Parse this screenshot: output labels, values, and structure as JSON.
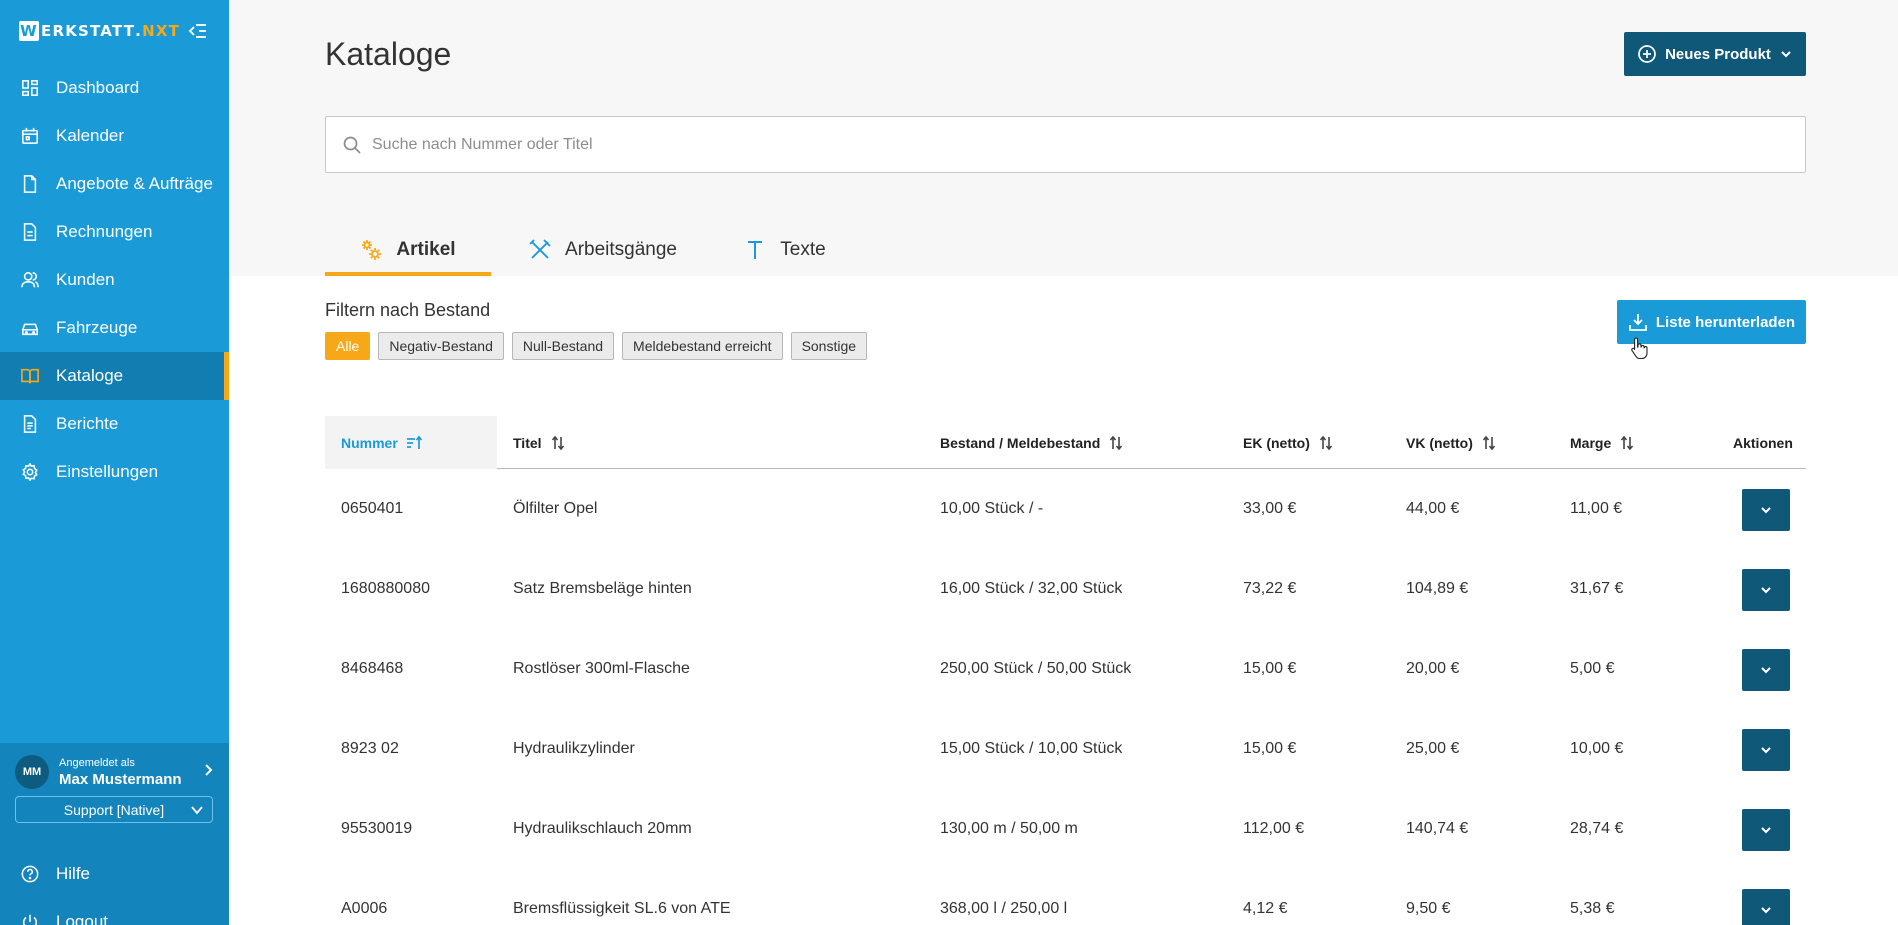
{
  "app": {
    "logo_main": "ERKSTATT",
    "logo_letter": "W",
    "logo_dot": ".",
    "logo_accent": "NXT"
  },
  "sidebar": {
    "items": [
      {
        "label": "Dashboard",
        "icon": "dashboard-icon"
      },
      {
        "label": "Kalender",
        "icon": "calendar-icon"
      },
      {
        "label": "Angebote & Aufträge",
        "icon": "document-icon"
      },
      {
        "label": "Rechnungen",
        "icon": "invoice-icon"
      },
      {
        "label": "Kunden",
        "icon": "users-icon"
      },
      {
        "label": "Fahrzeuge",
        "icon": "car-icon"
      },
      {
        "label": "Kataloge",
        "icon": "book-icon",
        "active": true
      },
      {
        "label": "Berichte",
        "icon": "report-icon"
      },
      {
        "label": "Einstellungen",
        "icon": "gear-icon"
      }
    ],
    "user": {
      "initials": "MM",
      "prefix": "Angemeldet als",
      "name": "Max Mustermann"
    },
    "support_label": "Support [Native]",
    "help_label": "Hilfe",
    "logout_label": "Logout"
  },
  "header": {
    "title": "Kataloge",
    "new_button": "Neues Produkt"
  },
  "search": {
    "placeholder": "Suche nach Nummer oder Titel",
    "value": ""
  },
  "tabs": [
    {
      "label": "Artikel",
      "icon": "gears-icon",
      "active": true
    },
    {
      "label": "Arbeitsgänge",
      "icon": "tools-icon"
    },
    {
      "label": "Texte",
      "icon": "text-icon"
    }
  ],
  "filter": {
    "label": "Filtern nach Bestand",
    "chips": [
      "Alle",
      "Negativ-Bestand",
      "Null-Bestand",
      "Meldebestand erreicht",
      "Sonstige"
    ],
    "active_chip": "Alle",
    "download_label": "Liste herunterladen"
  },
  "colors": {
    "sidebar": "#1a9bd7",
    "sidebar_active": "#117db0",
    "accent": "#f7a818",
    "dark_button": "#0f5878"
  },
  "table": {
    "columns": [
      "Nummer",
      "Titel",
      "Bestand / Meldebestand",
      "EK (netto)",
      "VK (netto)",
      "Marge",
      "Aktionen"
    ],
    "rows": [
      [
        "0650401",
        "Ölfilter Opel",
        "10,00 Stück / -",
        "33,00 €",
        "44,00 €",
        "11,00 €"
      ],
      [
        "1680880080",
        "Satz Bremsbeläge hinten",
        "16,00 Stück / 32,00 Stück",
        "73,22 €",
        "104,89 €",
        "31,67 €"
      ],
      [
        "8468468",
        "Rostlöser 300ml-Flasche",
        "250,00 Stück / 50,00 Stück",
        "15,00 €",
        "20,00 €",
        "5,00 €"
      ],
      [
        "8923 02",
        "Hydraulikzylinder",
        "15,00 Stück / 10,00 Stück",
        "15,00 €",
        "25,00 €",
        "10,00 €"
      ],
      [
        "95530019",
        "Hydraulikschlauch 20mm",
        "130,00 m / 50,00 m",
        "112,00 €",
        "140,74 €",
        "28,74 €"
      ],
      [
        "A0006",
        "Bremsflüssigkeit SL.6 von ATE",
        "368,00 l / 250,00 l",
        "4,12 €",
        "9,50 €",
        "5,38 €"
      ]
    ]
  }
}
